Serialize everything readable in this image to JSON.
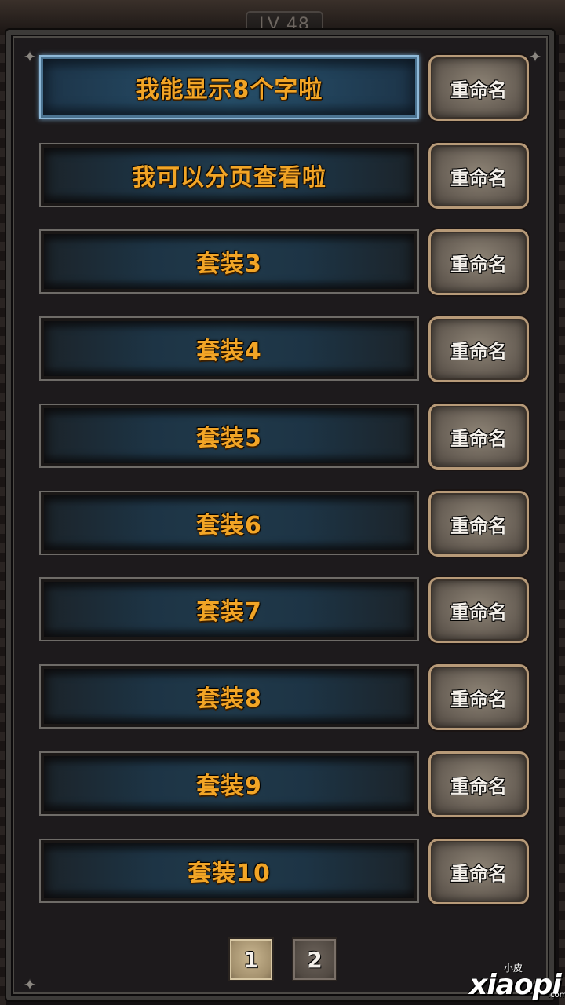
{
  "header": {
    "level_text": "LV 48"
  },
  "sets": [
    {
      "label": "我能显示8个字啦",
      "selected": true
    },
    {
      "label": "我可以分页查看啦",
      "selected": false
    },
    {
      "label": "套装3",
      "selected": false
    },
    {
      "label": "套装4",
      "selected": false
    },
    {
      "label": "套装5",
      "selected": false
    },
    {
      "label": "套装6",
      "selected": false
    },
    {
      "label": "套装7",
      "selected": false
    },
    {
      "label": "套装8",
      "selected": false
    },
    {
      "label": "套装9",
      "selected": false
    },
    {
      "label": "套装10",
      "selected": false
    }
  ],
  "rename_label": "重命名",
  "pagination": {
    "pages": [
      "1",
      "2"
    ],
    "current": "1"
  },
  "watermark": {
    "main": "xiaopi",
    "small": "小皮",
    "suffix": ".com"
  },
  "colors": {
    "set_label": "#f2a526",
    "selected_border": "#8fb9d8",
    "button_border": "#b79a78"
  }
}
